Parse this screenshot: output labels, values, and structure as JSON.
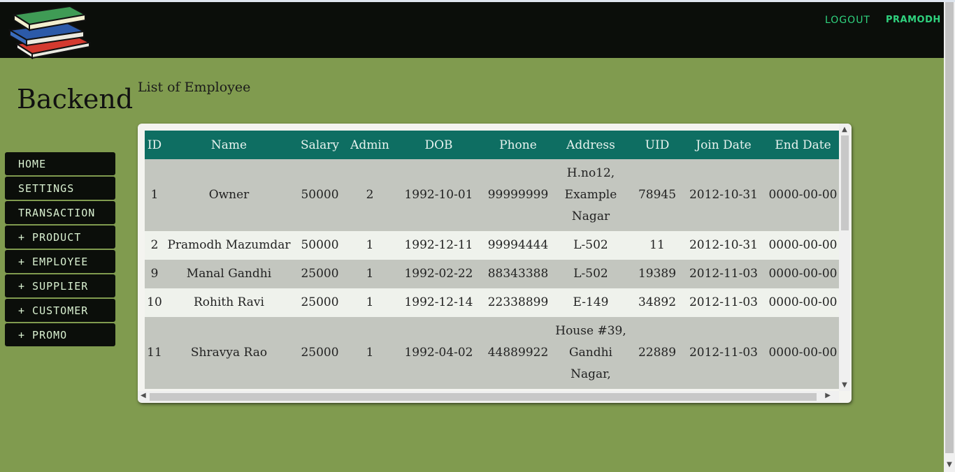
{
  "header": {
    "logout_label": "LOGOUT",
    "username": "PRAMODH"
  },
  "sidebar": {
    "brand": "Backend",
    "items": [
      {
        "label": "HOME"
      },
      {
        "label": "SETTINGS"
      },
      {
        "label": "TRANSACTION"
      },
      {
        "label": "+ PRODUCT"
      },
      {
        "label": "+ EMPLOYEE"
      },
      {
        "label": "+ SUPPLIER"
      },
      {
        "label": "+ CUSTOMER"
      },
      {
        "label": "+ PROMO"
      }
    ]
  },
  "main": {
    "title": "List of Employee",
    "table": {
      "columns": [
        "ID",
        "Name",
        "Salary",
        "Admin",
        "DOB",
        "Phone",
        "Address",
        "UID",
        "Join Date",
        "End Date"
      ],
      "rows": [
        [
          "1",
          "Owner",
          "50000",
          "2",
          "1992-10-01",
          "99999999",
          "H.no12, Example Nagar",
          "78945",
          "2012-10-31",
          "0000-00-00"
        ],
        [
          "2",
          "Pramodh Mazumdar",
          "50000",
          "1",
          "1992-12-11",
          "99994444",
          "L-502",
          "11",
          "2012-10-31",
          "0000-00-00"
        ],
        [
          "9",
          "Manal Gandhi",
          "25000",
          "1",
          "1992-02-22",
          "88343388",
          "L-502",
          "19389",
          "2012-11-03",
          "0000-00-00"
        ],
        [
          "10",
          "Rohith Ravi",
          "25000",
          "1",
          "1992-12-14",
          "22338899",
          "E-149",
          "34892",
          "2012-11-03",
          "0000-00-00"
        ],
        [
          "11",
          "Shravya Rao",
          "25000",
          "1",
          "1992-04-02",
          "44889922",
          "House #39, Gandhi Nagar,",
          "22889",
          "2012-11-03",
          "0000-00-00"
        ]
      ]
    }
  },
  "colors": {
    "page_bg": "#809b4f",
    "header_bg": "#0b0e0a",
    "accent_text": "#2fd27e",
    "table_header_bg": "#0e6e62",
    "row_odd": "#c3c6bf",
    "row_even": "#eff2ec"
  },
  "icons": {
    "logo": "books-stack-logo"
  }
}
